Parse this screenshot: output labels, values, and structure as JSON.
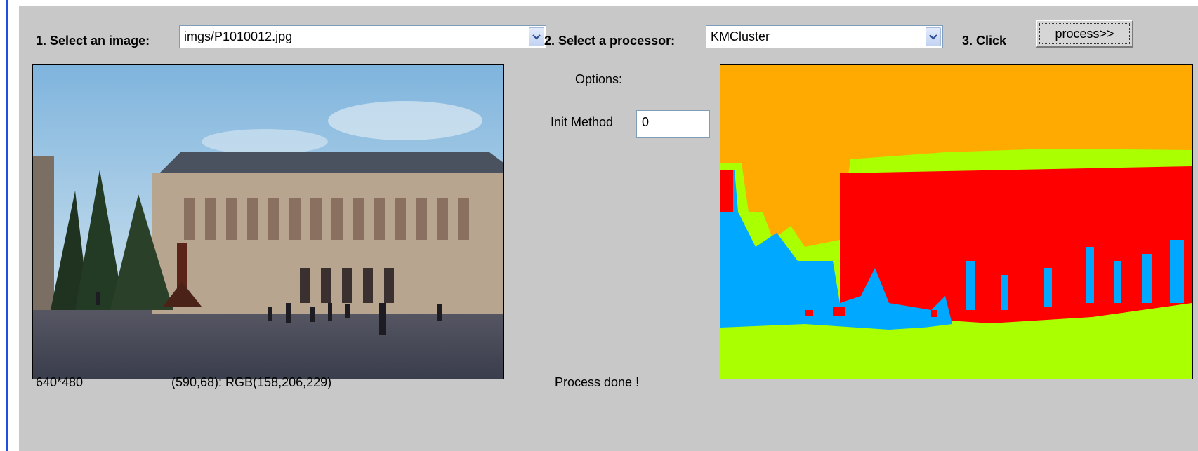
{
  "toolbar": {
    "step1_label": "1. Select an image:",
    "image_select_value": "imgs/P1010012.jpg",
    "step2_label": "2. Select a processor:",
    "processor_select_value": "KMCluster",
    "step3_label": "3. Click",
    "process_button_label": "process>>"
  },
  "options": {
    "title": "Options:",
    "init_method_label": "Init Method",
    "init_method_value": "0"
  },
  "status": {
    "image_size": "640*480",
    "pixel_info": "(590,68): RGB(158,206,229)",
    "process_message": "Process done !"
  },
  "icons": {
    "dropdown_arrow": "chevron-down-icon"
  },
  "colors": {
    "panel_background": "#c8c8c8",
    "accent_bar": "#1f4fe0",
    "cluster_sky": "#ffaa00",
    "cluster_building": "#ff0000",
    "cluster_shadow": "#00a8ff",
    "cluster_ground": "#aaff00"
  }
}
